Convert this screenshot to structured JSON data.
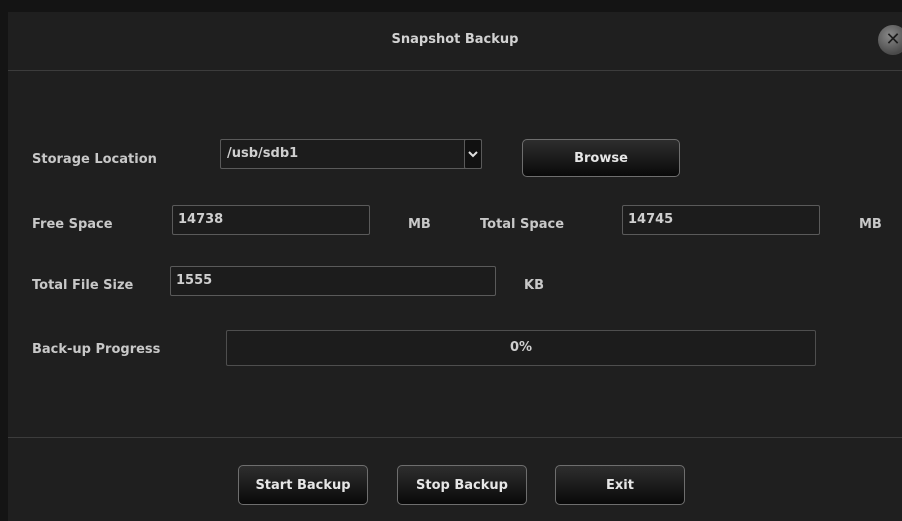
{
  "dialog": {
    "title": "Snapshot Backup",
    "close_symbol": "✕"
  },
  "storage": {
    "label": "Storage Location",
    "selected": "/usb/sdb1",
    "arrow": "⌄",
    "browse_label": "Browse"
  },
  "free_space": {
    "label": "Free Space",
    "value": "14738",
    "unit": "MB"
  },
  "total_space": {
    "label": "Total Space",
    "value": "14745",
    "unit": "MB"
  },
  "total_file_size": {
    "label": "Total File Size",
    "value": "1555",
    "unit": "KB"
  },
  "progress": {
    "label": "Back-up Progress",
    "text": "0%",
    "percent": 0
  },
  "buttons": {
    "start": "Start Backup",
    "stop": "Stop Backup",
    "exit": "Exit"
  },
  "colors": {
    "background": "#1f1f1f",
    "text": "#cfcfcf",
    "border": "#5a5a5a"
  },
  "icons": {
    "close": "close-icon",
    "dropdown": "chevron-down-icon"
  }
}
